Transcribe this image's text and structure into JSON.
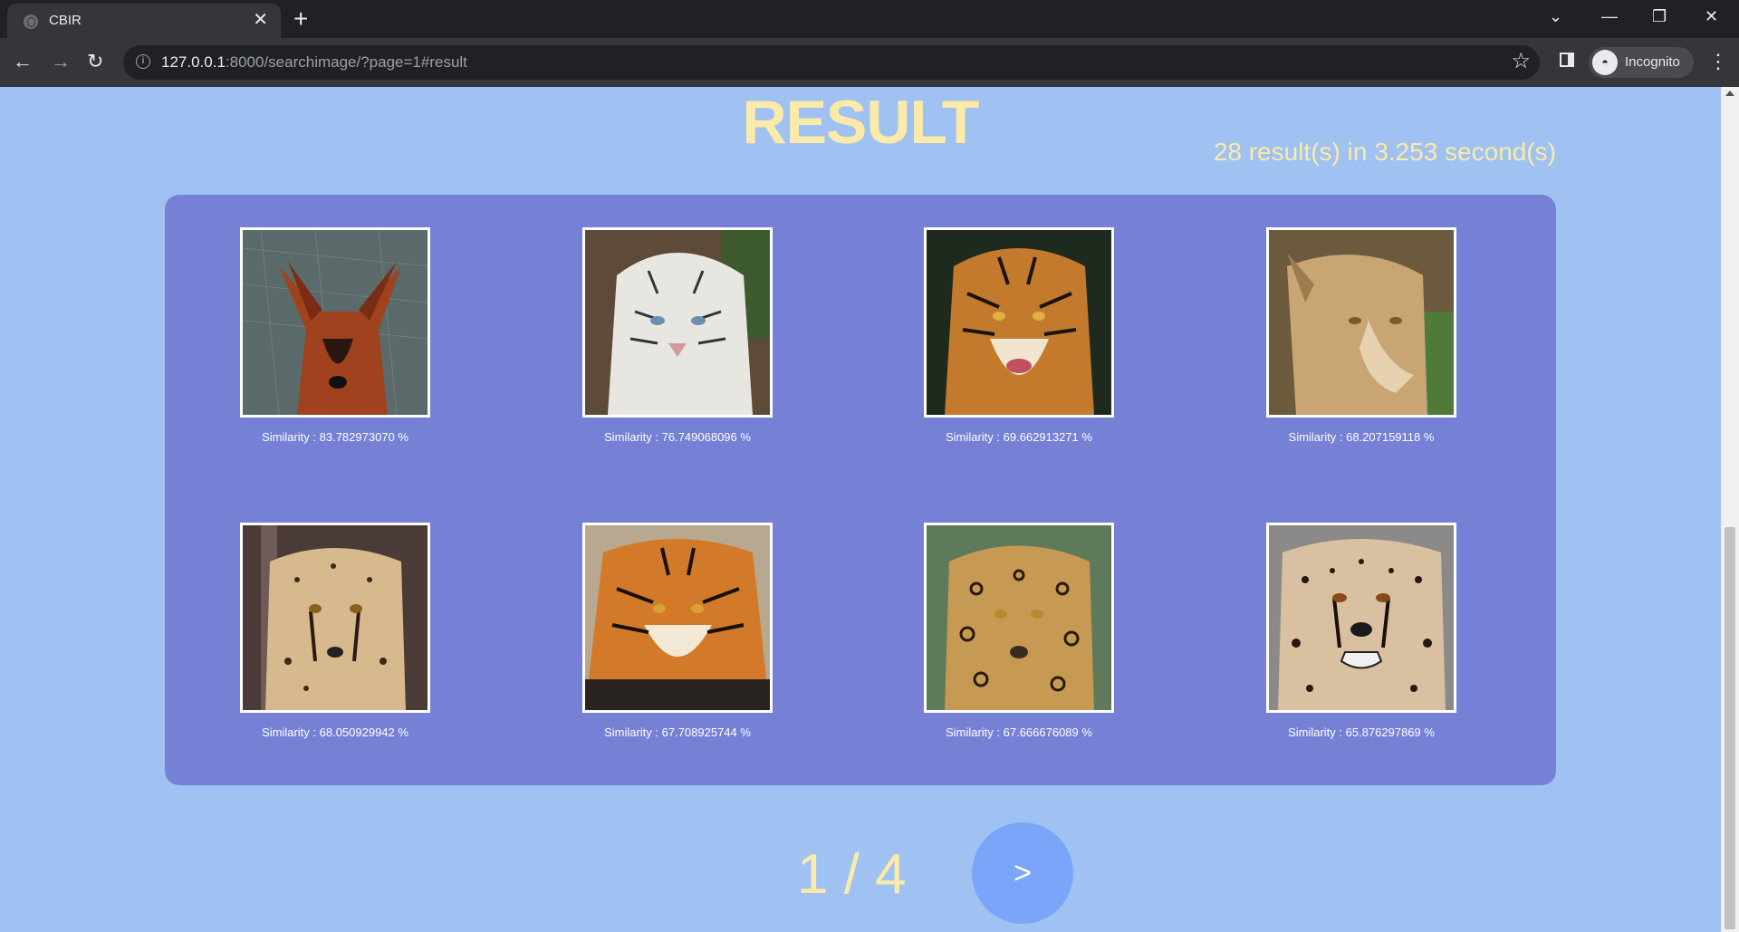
{
  "browser": {
    "tab_title": "CBIR",
    "url_host": "127.0.0.1",
    "url_rest": ":8000/searchimage/?page=1#result",
    "profile_label": "Incognito"
  },
  "page": {
    "title": "RESULT",
    "stats": "28 result(s) in 3.253 second(s)",
    "pagination": "1 / 4",
    "next_label": ">"
  },
  "results": [
    {
      "similarity": "Similarity : 83.782973070 %",
      "image": "maned-wolf"
    },
    {
      "similarity": "Similarity : 76.749068096 %",
      "image": "white-tiger"
    },
    {
      "similarity": "Similarity : 69.662913271 %",
      "image": "tiger"
    },
    {
      "similarity": "Similarity : 68.207159118 %",
      "image": "lioness"
    },
    {
      "similarity": "Similarity : 68.050929942 %",
      "image": "cheetah"
    },
    {
      "similarity": "Similarity : 67.708925744 %",
      "image": "bengal-tiger"
    },
    {
      "similarity": "Similarity : 67.666676089 %",
      "image": "jaguar"
    },
    {
      "similarity": "Similarity : 65.876297869 %",
      "image": "cheetah-closeup"
    }
  ],
  "colors": {
    "page_bg": "#9fc2f3",
    "panel_bg": "#7681d6",
    "title_color": "#fbeaa8",
    "next_button": "#7aa5f8"
  }
}
